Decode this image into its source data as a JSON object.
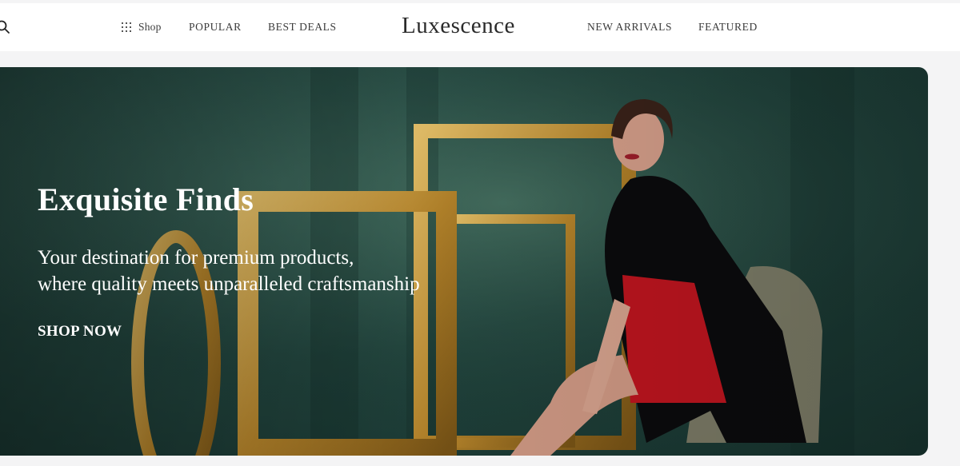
{
  "header": {
    "search_icon": "search-icon",
    "nav_left": {
      "shop_label": "Shop",
      "shop_icon": "grid-icon",
      "popular_label": "POPULAR",
      "best_deals_label": "BEST DEALS"
    },
    "brand": "Luxescence",
    "nav_right": {
      "new_arrivals_label": "NEW ARRIVALS",
      "featured_label": "FEATURED"
    }
  },
  "hero": {
    "title": "Exquisite Finds",
    "subtitle_line1": "Your destination for premium products,",
    "subtitle_line2": "where quality meets unparalleled craftsmanship",
    "cta_label": "SHOP NOW"
  },
  "colors": {
    "header_bg": "#ffffff",
    "page_bg": "#f4f4f5",
    "nav_text": "#3b3b3b",
    "hero_text": "#ffffff",
    "hero_wall": "#234740",
    "frame_gold": "#c79a3a",
    "dress_red": "#c0151f",
    "coat_black": "#0b0b0d"
  }
}
